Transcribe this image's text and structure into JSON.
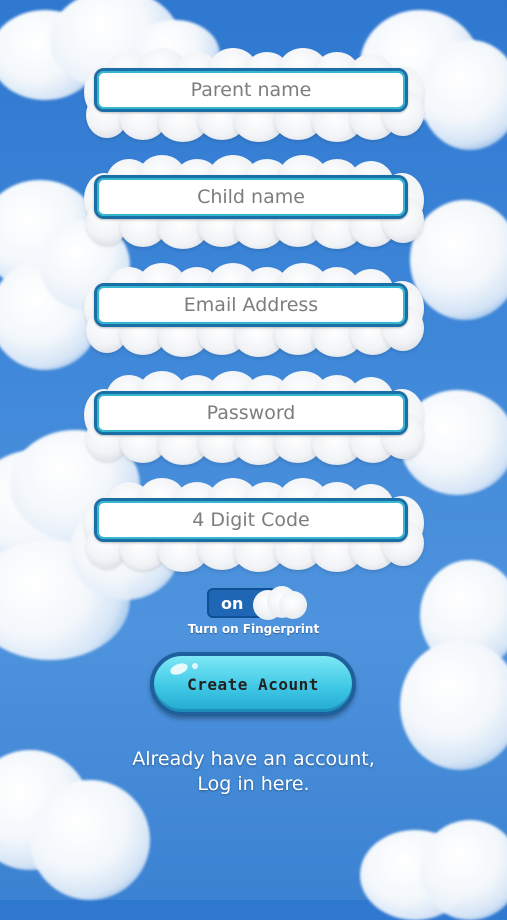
{
  "form": {
    "fields": [
      {
        "name": "parent-name-field",
        "placeholder": "Parent name",
        "value": ""
      },
      {
        "name": "child-name-field",
        "placeholder": "Child name",
        "value": ""
      },
      {
        "name": "email-field",
        "placeholder": "Email Address",
        "value": ""
      },
      {
        "name": "password-field",
        "placeholder": "Password",
        "value": ""
      },
      {
        "name": "digit-code-field",
        "placeholder": "4 Digit Code",
        "value": ""
      }
    ]
  },
  "fingerprint": {
    "toggle_label": "on",
    "caption": "Turn on Fingerprint",
    "enabled": true
  },
  "create_button": {
    "label": "Create Acount"
  },
  "login": {
    "line1": "Already have an account,",
    "line2": "Log in here."
  },
  "colors": {
    "sky": "#3d86d8",
    "field_border": "#1a6fa6",
    "button": "#3fc9e6",
    "toggle": "#1f66b5"
  }
}
